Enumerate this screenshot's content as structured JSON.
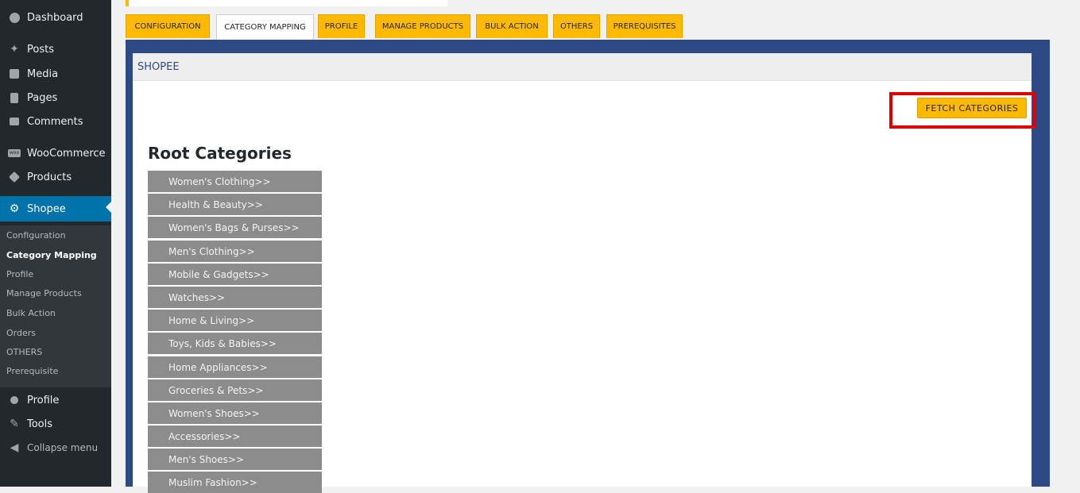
{
  "sidebar": {
    "top_items": [
      {
        "label": "Dashboard",
        "icon": "dashboard-icon"
      },
      {
        "label": "Posts",
        "icon": "pin-icon"
      },
      {
        "label": "Media",
        "icon": "media-icon"
      },
      {
        "label": "Pages",
        "icon": "pages-icon"
      },
      {
        "label": "Comments",
        "icon": "comment-icon"
      },
      {
        "label": "WooCommerce",
        "icon": "woocommerce-icon"
      },
      {
        "label": "Products",
        "icon": "products-icon"
      },
      {
        "label": "Shopee",
        "icon": "gear-icon"
      }
    ],
    "submenu": [
      {
        "label": "Configuration"
      },
      {
        "label": "Category Mapping"
      },
      {
        "label": "Profile"
      },
      {
        "label": "Manage Products"
      },
      {
        "label": "Bulk Action"
      },
      {
        "label": "Orders"
      },
      {
        "label": "OTHERS"
      },
      {
        "label": "Prerequisite"
      }
    ],
    "bottom_items": [
      {
        "label": "Profile",
        "icon": "user-icon"
      },
      {
        "label": "Tools",
        "icon": "wrench-icon"
      },
      {
        "label": "Collapse menu",
        "icon": "collapse-icon"
      }
    ],
    "active_color": "#0073aa"
  },
  "tabs": [
    {
      "label": "CONFIGURATION"
    },
    {
      "label": "CATEGORY MAPPING"
    },
    {
      "label": "PROFILE"
    },
    {
      "label": "MANAGE PRODUCTS"
    },
    {
      "label": "BULK ACTION"
    },
    {
      "label": "OTHERS"
    },
    {
      "label": "PREREQUISITES"
    }
  ],
  "active_tab": "CATEGORY MAPPING",
  "panel": {
    "header": "SHOPEE",
    "fetch_button": "FETCH CATEGORIES",
    "root_title": "Root Categories",
    "categories": [
      "Women's Clothing>>",
      "Health & Beauty>>",
      "Women's Bags & Purses>>",
      "Men's Clothing>>",
      "Mobile & Gadgets>>",
      "Watches>>",
      "Home & Living>>",
      "Toys, Kids & Babies>>",
      "Home Appliances>>",
      "Groceries & Pets>>",
      "Women's Shoes>>",
      "Accessories>>",
      "Men's Shoes>>",
      "Muslim Fashion>>"
    ]
  },
  "colors": {
    "accent": "#ffb900",
    "frame": "#2e4a85",
    "highlight": "#e00000",
    "category_bg": "#8c8c8c"
  }
}
